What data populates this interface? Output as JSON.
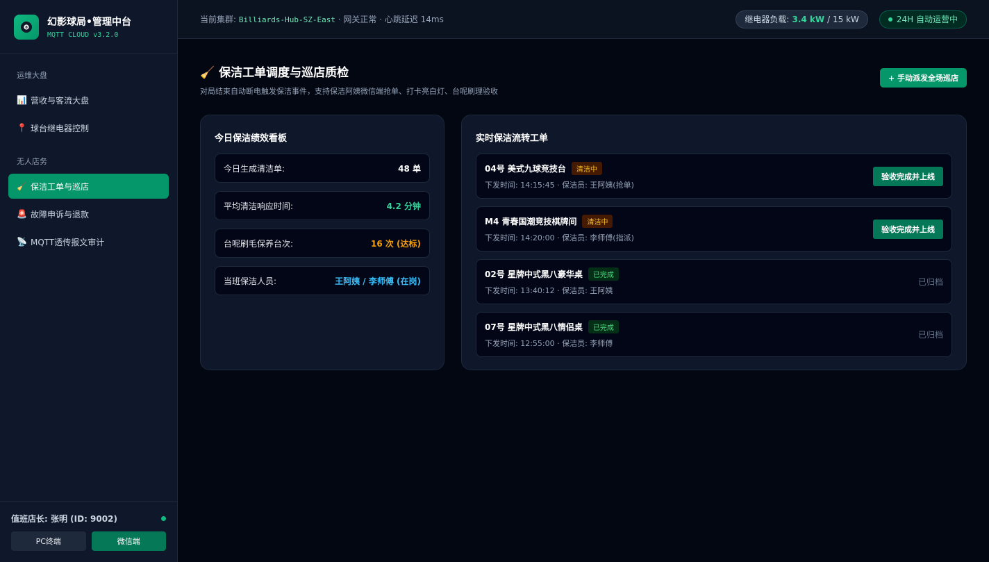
{
  "brand": {
    "title": "幻影球局•管理中台",
    "version": "MQTT CLOUD v3.2.0",
    "logo_icon": "billiard-ball-icon",
    "accent": "#10b981"
  },
  "sidebar": {
    "sections": [
      {
        "heading": "运维大盘",
        "items": [
          {
            "icon": "📊",
            "label": "营收与客流大盘"
          },
          {
            "icon": "📍",
            "label": "球台继电器控制"
          }
        ]
      },
      {
        "heading": "无人店务",
        "items": [
          {
            "icon": "🧹",
            "label": "保洁工单与巡店"
          },
          {
            "icon": "🚨",
            "label": "故障申诉与退款"
          },
          {
            "icon": "📡",
            "label": "MQTT透传报文审计"
          }
        ]
      }
    ],
    "operator": "值班店长: 张明 (ID: 9002)",
    "clients": {
      "pc": "PC终端",
      "wechat": "微信端"
    }
  },
  "topbar": {
    "cluster_prefix": "当前集群: ",
    "cluster_name": "Billiards-Hub-SZ-East",
    "cluster_suffix": " · 网关正常 · 心跳延迟 14ms",
    "load_label": "继电器负载: ",
    "load_value": "3.4 kW",
    "load_max": "/ 15 kW",
    "status": "24H 自动运营中"
  },
  "page": {
    "icon": "🧹",
    "title": "保洁工单调度与巡店质检",
    "subtitle": "对局结束自动断电触发保洁事件，支持保洁阿姨微信端抢单、打卡亮白灯、台呢刷理验收",
    "dispatch_button": "+ 手动派发全场巡店"
  },
  "performance": {
    "title": "今日保洁绩效看板",
    "stats": [
      {
        "label": "今日生成清洁单:",
        "value": "48 单"
      },
      {
        "label": "平均清洁响应时间:",
        "value": "4.2 分钟"
      },
      {
        "label": "台呢刷毛保养台次:",
        "value": "16 次 (达标)"
      },
      {
        "label": "当班保洁人员:",
        "value": "王阿姨 / 李师傅 (在岗)"
      }
    ]
  },
  "orders": {
    "title": "实时保洁流转工单",
    "verify_label": "验收完成并上线",
    "archived_label": "已归档",
    "items": [
      {
        "name": "04号 美式九球竞技台",
        "status": "清洁中",
        "meta": "下发时间: 14:15:45 · 保洁员: 王阿姨(抢单)"
      },
      {
        "name": "M4 青春国潮竞技棋牌间",
        "status": "清洁中",
        "meta": "下发时间: 14:20:00 · 保洁员: 李师傅(指派)"
      },
      {
        "name": "02号 星牌中式黑八豪华桌",
        "status": "已完成",
        "meta": "下发时间: 13:40:12 · 保洁员: 王阿姨"
      },
      {
        "name": "07号 星牌中式黑八情侣桌",
        "status": "已完成",
        "meta": "下发时间: 12:55:00 · 保洁员: 李师傅"
      }
    ]
  }
}
